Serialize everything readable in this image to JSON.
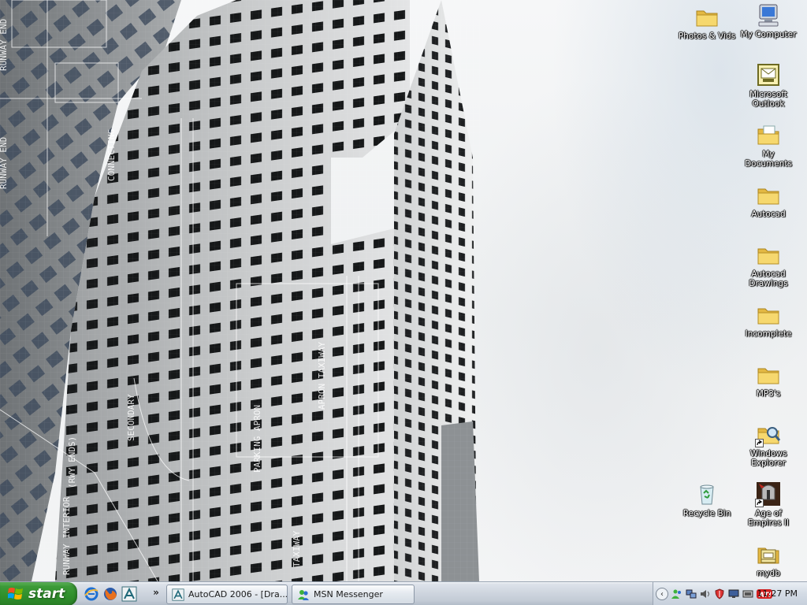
{
  "desktop": {
    "icons": [
      {
        "label": "Photos & Vids",
        "icon": "folder-icon"
      },
      {
        "label": "My Computer",
        "icon": "computer-icon"
      },
      {
        "label": "Microsoft Outlook",
        "icon": "outlook-icon"
      },
      {
        "label": "My Documents",
        "icon": "documents-folder-icon"
      },
      {
        "label": "Autocad",
        "icon": "folder-icon"
      },
      {
        "label": "Autocad Drawings",
        "icon": "folder-icon"
      },
      {
        "label": "Incomplete",
        "icon": "folder-icon"
      },
      {
        "label": "MP3's",
        "icon": "folder-icon"
      },
      {
        "label": "Windows Explorer",
        "icon": "explorer-icon"
      },
      {
        "label": "Recycle Bin",
        "icon": "recycle-bin-icon"
      },
      {
        "label": "Age of Empires II",
        "icon": "age-of-empires-icon"
      },
      {
        "label": "mydb",
        "icon": "rar-archive-icon"
      }
    ]
  },
  "taskbar": {
    "start_label": "start",
    "quick_launch": [
      {
        "icon": "internet-explorer-icon"
      },
      {
        "icon": "firefox-icon"
      },
      {
        "icon": "autocad-icon"
      }
    ],
    "quick_launch_more": "»",
    "tasks": [
      {
        "label": "AutoCAD 2006 - [Dra...",
        "icon": "autocad-icon"
      },
      {
        "label": "MSN Messenger",
        "icon": "msn-messenger-icon"
      }
    ],
    "tray_chevron": "‹",
    "clock": "11:27 PM"
  },
  "colors": {
    "start_green": "#2f8f2b",
    "taskbar_silver": "#cfd6df",
    "folder_yellow": "#f4d262"
  }
}
